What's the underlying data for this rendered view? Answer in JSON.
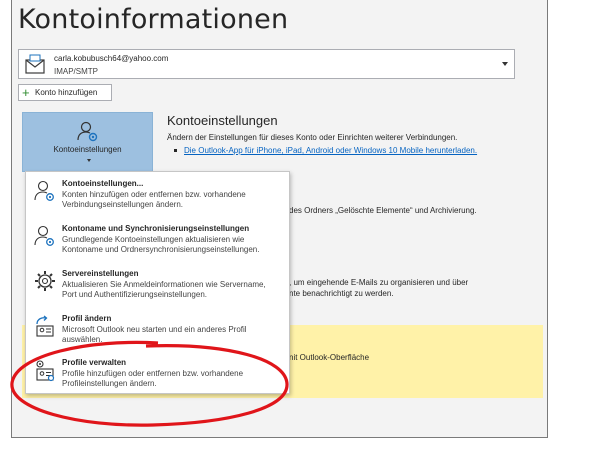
{
  "page_title": "Kontoinformationen",
  "account": {
    "email": "carla.kobubusch64@yahoo.com",
    "type": "IMAP/SMTP"
  },
  "add_account_label": "Konto hinzufügen",
  "account_settings_button": {
    "label": "Kontoeinstellungen",
    "icon": "account-settings-icon"
  },
  "section": {
    "title": "Kontoeinstellungen",
    "description": "Ändern der Einstellungen für dieses Konto oder Einrichten weiterer Verbindungen.",
    "link": "Die Outlook-App für iPhone, iPad, Android oder Windows 10 Mobile herunterladen."
  },
  "background_texts": [
    "des Ordners „Gelöschte Elemente“ und Archivierung.",
    ", um eingehende E-Mails zu organisieren und über",
    "nte benachrichtigt zu werden.",
    "nit Outlook-Oberfläche"
  ],
  "menu": {
    "items": [
      {
        "title": "Kontoeinstellungen...",
        "description": "Konten hinzufügen oder entfernen bzw. vorhandene Verbindungseinstellungen ändern.",
        "icon": "person-gear-icon"
      },
      {
        "title": "Kontoname und Synchronisierungseinstellungen",
        "description": "Grundlegende Kontoeinstellungen aktualisieren wie Kontoname und Ordnersynchronisierungseinstellungen.",
        "icon": "person-gear-icon"
      },
      {
        "title": "Servereinstellungen",
        "description": "Aktualisieren Sie Anmeldeinformationen wie Servername, Port und Authentifizierungseinstellungen.",
        "icon": "gear-icon"
      },
      {
        "title": "Profil ändern",
        "description": "Microsoft Outlook neu starten und ein anderes Profil auswählen.",
        "icon": "profile-switch-icon"
      },
      {
        "title": "Profile verwalten",
        "description": "Profile hinzufügen oder entfernen bzw. vorhandene Profileinstellungen ändern.",
        "icon": "profile-manage-icon"
      }
    ]
  },
  "colors": {
    "accent_blue": "#9dc0e0",
    "link_blue": "#0563c1",
    "highlight_yellow": "#fff2a8",
    "annotation_red": "#e0151a"
  }
}
